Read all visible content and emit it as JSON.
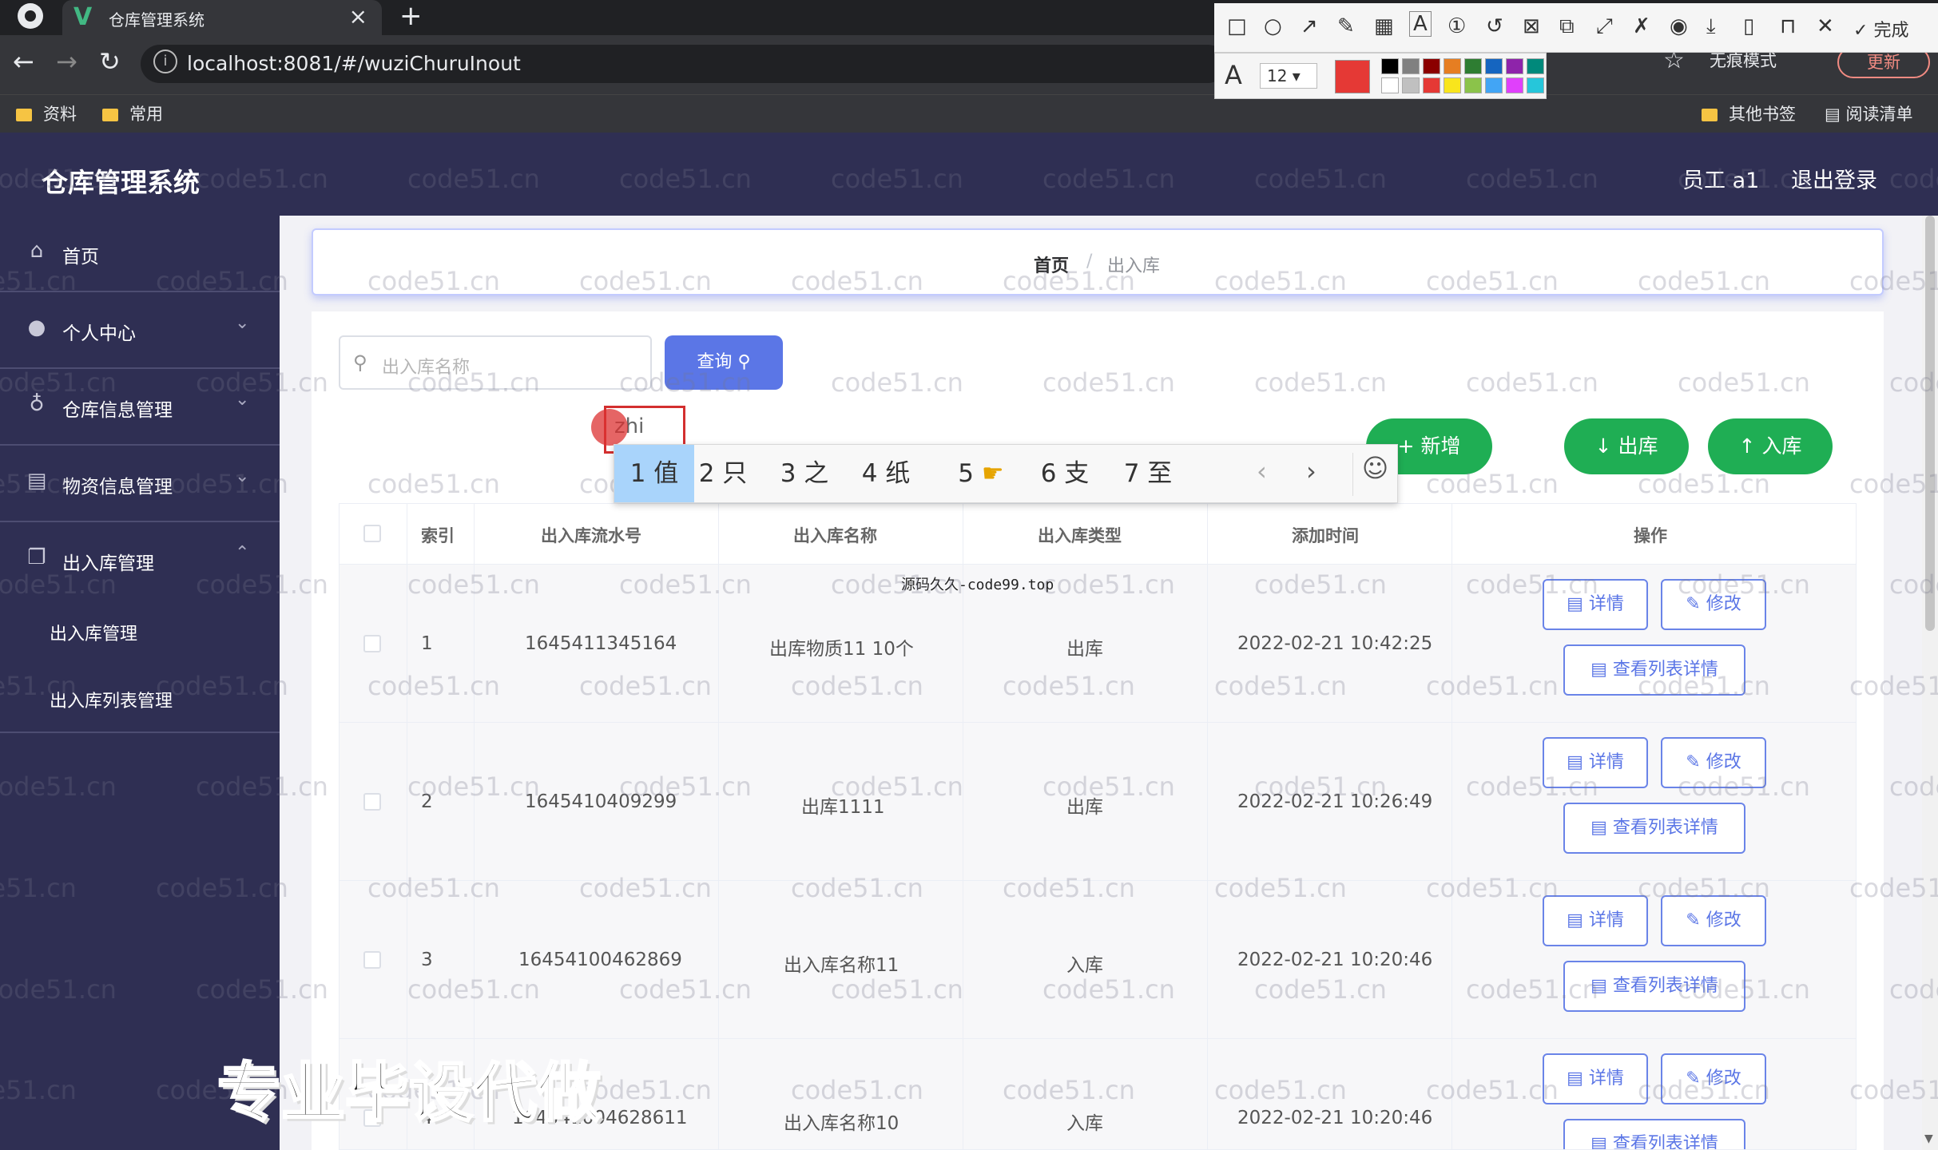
{
  "browser": {
    "tab_title": "仓库管理系统",
    "url": "localhost:8081/#/wuziChuruInout",
    "incognito": "无痕模式",
    "update": "更新",
    "bookmarks": [
      "资料",
      "常用"
    ],
    "bookmarks_right": [
      "其他书签",
      "阅读清单"
    ]
  },
  "screenshot_tool": {
    "font_size": "12",
    "done": "完成"
  },
  "app": {
    "title": "仓库管理系统",
    "user": "员工 a1",
    "logout": "退出登录"
  },
  "sidebar": {
    "items": [
      {
        "label": "首页"
      },
      {
        "label": "个人中心"
      },
      {
        "label": "仓库信息管理"
      },
      {
        "label": "物资信息管理"
      },
      {
        "label": "出入库管理"
      }
    ],
    "sub_items": [
      "出入库管理",
      "出入库列表管理"
    ]
  },
  "breadcrumb": {
    "home": "首页",
    "sep": "/",
    "current": "出入库"
  },
  "search": {
    "placeholder": "出入库名称",
    "query_button": "查询"
  },
  "actions": {
    "add": "+ 新增",
    "out": "↓ 出库",
    "in": "↑ 入库"
  },
  "ime": {
    "input": "zhi",
    "candidates": [
      "1 值",
      "2 只",
      "3 之",
      "4 纸",
      "5",
      "6 支",
      "7 至"
    ],
    "prev": "‹",
    "next": "›"
  },
  "table": {
    "headers": [
      "索引",
      "出入库流水号",
      "出入库名称",
      "出入库类型",
      "添加时间",
      "操作"
    ],
    "rows": [
      {
        "index": "1",
        "serial": "1645411345164",
        "name": "出库物质11 10个",
        "type": "出库",
        "time": "2022-02-21 10:42:25"
      },
      {
        "index": "2",
        "serial": "1645410409299",
        "name": "出库1111",
        "type": "出库",
        "time": "2022-02-21 10:26:49"
      },
      {
        "index": "3",
        "serial": "16454100462869",
        "name": "出入库名称11",
        "type": "入库",
        "time": "2022-02-21 10:20:46"
      },
      {
        "index": "4",
        "serial": "164541004628611",
        "name": "出入库名称10",
        "type": "入库",
        "time": "2022-02-21 10:20:46"
      }
    ],
    "btn_detail": "详情",
    "btn_edit": "修改",
    "btn_list": "查看列表详情"
  },
  "watermark": "code51.cn",
  "source_note": "源码久久-code99.top",
  "overlay_text": "专业毕设代做",
  "colors": {
    "header": "#2f2f53",
    "primary": "#5b76e6",
    "success": "#1fae54"
  }
}
